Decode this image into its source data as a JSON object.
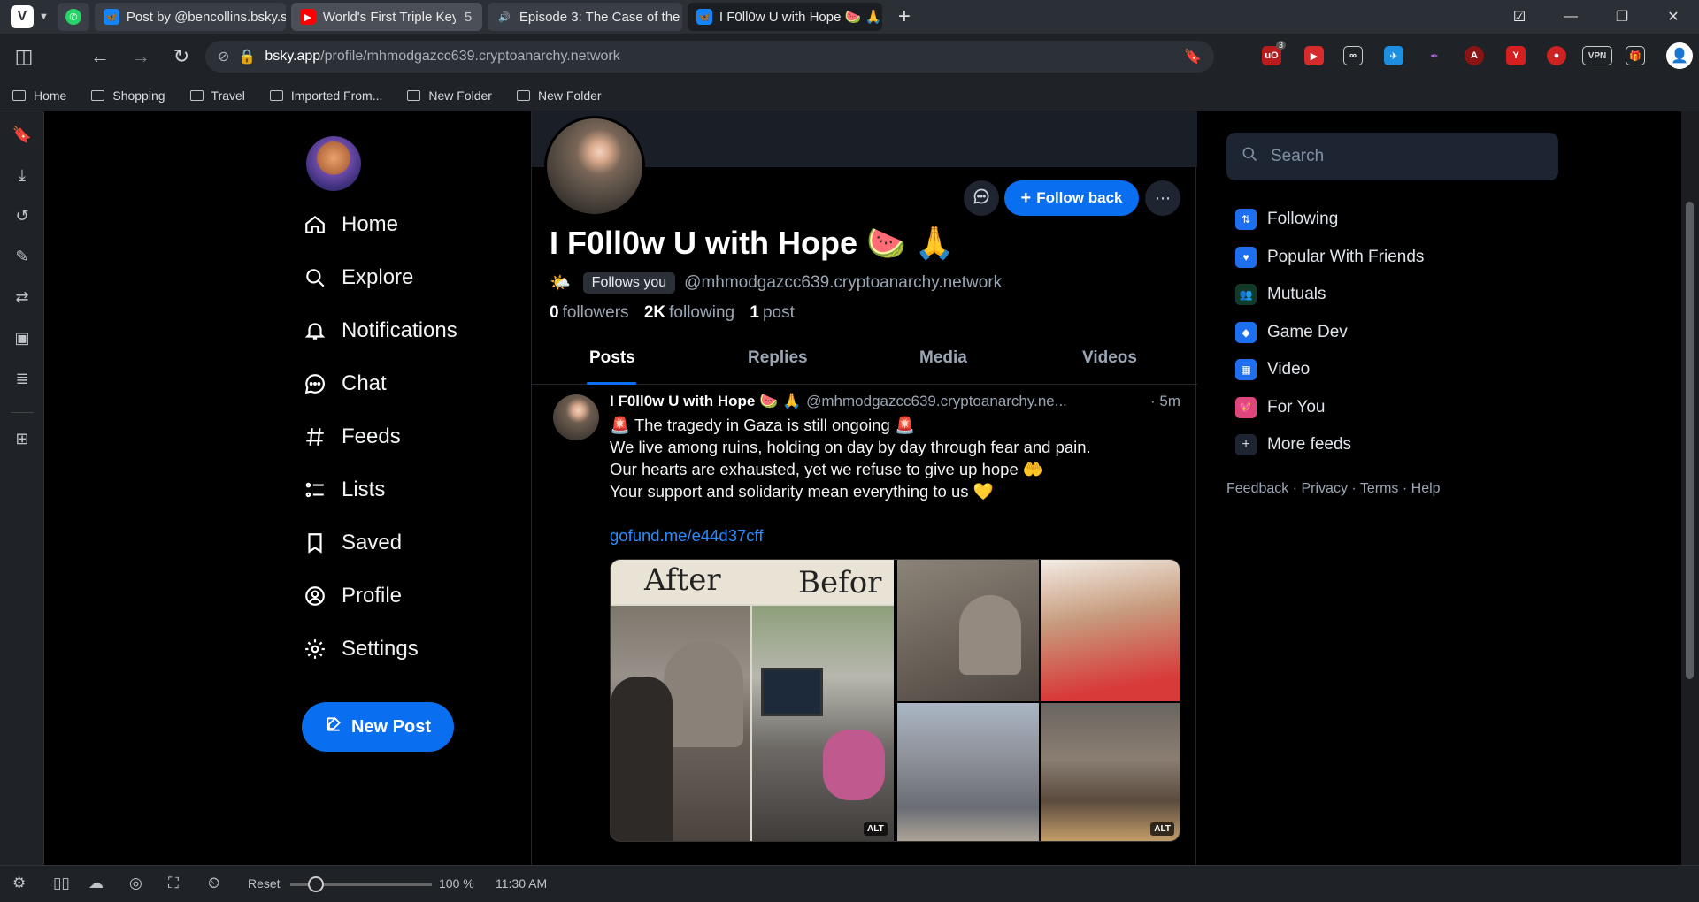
{
  "browser": {
    "tabs": [
      {
        "label": "",
        "icon": "whatsapp-icon",
        "color": "#25d366"
      },
      {
        "label": "Post by @bencollins.bsky.so",
        "icon": "butterfly-icon",
        "color": "#1185fe"
      },
      {
        "label": "World's First Triple Keyb",
        "count": "5",
        "icon": "youtube-icon",
        "color": "#ff0000"
      },
      {
        "label": "Episode 3: The Case of the",
        "icon": "speaker-icon",
        "color": "#cccccc"
      },
      {
        "label": "I F0ll0w U with Hope 🍉 🙏",
        "icon": "butterfly-icon",
        "color": "#1185fe"
      }
    ],
    "url_host": "bsky.app",
    "url_path": "/profile/mhmodgazcc639.cryptoanarchy.network",
    "extension_badge": "3",
    "vpn_label": "VPN",
    "bookmarks": [
      "Home",
      "Shopping",
      "Travel",
      "Imported From...",
      "New Folder",
      "New Folder"
    ],
    "status": {
      "reset": "Reset",
      "zoom": "100 %",
      "time": "11:30 AM"
    }
  },
  "nav": {
    "items": [
      "Home",
      "Explore",
      "Notifications",
      "Chat",
      "Feeds",
      "Lists",
      "Saved",
      "Profile",
      "Settings"
    ],
    "new_post": "New Post"
  },
  "profile": {
    "name": "I F0ll0w U with Hope 🍉 🙏",
    "sun_emoji": "🌤️",
    "follows_you": "Follows you",
    "handle": "@mhmodgazcc639.cryptoanarchy.network",
    "followers_count": "0",
    "followers_label": "followers",
    "following_count": "2K",
    "following_label": "following",
    "posts_count": "1",
    "posts_label": "post",
    "follow_back": "Follow back",
    "tabs": [
      "Posts",
      "Replies",
      "Media",
      "Videos"
    ]
  },
  "post": {
    "author": "I F0ll0w U with Hope 🍉 🙏",
    "handle": "@mhmodgazcc639.cryptoanarchy.ne...",
    "time": "· 5m",
    "lines": [
      "🚨 The tragedy in Gaza is still ongoing 🚨",
      "We live among ruins, holding on day by day through fear and pain.",
      "Our hearts are exhausted, yet we refuse to give up hope 🤲",
      "Your support and solidarity mean everything to us 💛"
    ],
    "link": "gofund.me/e44d37cff",
    "image_text_after": "After",
    "image_text_before": "Befor",
    "alt_badge": "ALT"
  },
  "right": {
    "search_placeholder": "Search",
    "feeds": [
      {
        "label": "Following",
        "color": "#1e6ff0"
      },
      {
        "label": "Popular With Friends",
        "color": "#1e6ff0"
      },
      {
        "label": "Mutuals",
        "color": "#1f8a55"
      },
      {
        "label": "Game Dev",
        "color": "#1e6ff0"
      },
      {
        "label": "Video",
        "color": "#1e6ff0"
      },
      {
        "label": "For You",
        "color": "#e0467c"
      },
      {
        "label": "More feeds",
        "color": "#2a3240"
      }
    ],
    "footer": [
      "Feedback",
      "Privacy",
      "Terms",
      "Help"
    ]
  }
}
